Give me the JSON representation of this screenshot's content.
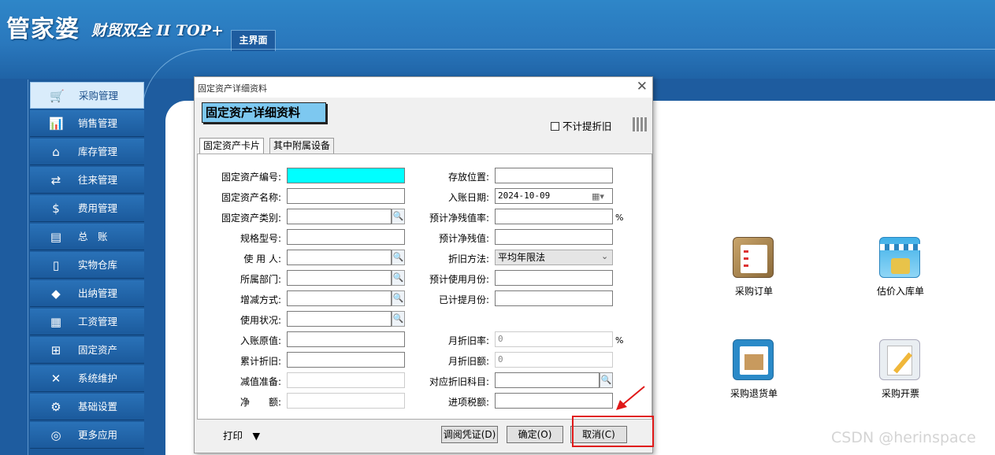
{
  "app": {
    "logo": "管家婆",
    "logo_sub": "财贸双全 II TOP+",
    "home_tab": "主界面"
  },
  "sidebar": {
    "items": [
      {
        "label": "采购管理",
        "icon": "cart-icon",
        "glyph": "🛒"
      },
      {
        "label": "销售管理",
        "icon": "chart-icon",
        "glyph": "📊"
      },
      {
        "label": "库存管理",
        "icon": "home-icon",
        "glyph": "⌂"
      },
      {
        "label": "往来管理",
        "icon": "exchange-icon",
        "glyph": "⇄"
      },
      {
        "label": "费用管理",
        "icon": "dollar-icon",
        "glyph": "$"
      },
      {
        "label": "总　账",
        "icon": "ledger-icon",
        "glyph": "▤"
      },
      {
        "label": "实物仓库",
        "icon": "document-icon",
        "glyph": "▯"
      },
      {
        "label": "出纳管理",
        "icon": "money-bag-icon",
        "glyph": "◆"
      },
      {
        "label": "工资管理",
        "icon": "grid-icon",
        "glyph": "▦"
      },
      {
        "label": "固定资产",
        "icon": "hierarchy-icon",
        "glyph": "⊞"
      },
      {
        "label": "系统维护",
        "icon": "tools-icon",
        "glyph": "✕"
      },
      {
        "label": "基础设置",
        "icon": "gear-icon",
        "glyph": "⚙"
      },
      {
        "label": "更多应用",
        "icon": "more-icon",
        "glyph": "◎"
      }
    ]
  },
  "tiles": [
    {
      "label": "采购订单",
      "icon": "clipboard-icon"
    },
    {
      "label": "估价入库单",
      "icon": "store-icon"
    },
    {
      "label": "采购退货单",
      "icon": "box-return-icon"
    },
    {
      "label": "采购开票",
      "icon": "invoice-icon"
    }
  ],
  "dialog": {
    "title": "固定资产详细资料",
    "heading": "固定资产详细资料",
    "no_depreciation_label": "不计提折旧",
    "tabs": [
      "固定资产卡片",
      "其中附属设备"
    ],
    "left_labels": [
      "固定资产编号:",
      "固定资产名称:",
      "固定资产类别:",
      "规格型号:",
      "使 用 人:",
      "所属部门:",
      "增减方式:",
      "使用状况:",
      "入账原值:",
      "累计折旧:",
      "减值准备:",
      "净　　额:"
    ],
    "right_labels": [
      "存放位置:",
      "入账日期:",
      "预计净残值率:",
      "预计净残值:",
      "折旧方法:",
      "预计使用月份:",
      "已计提月份:",
      "月折旧率:",
      "月折旧额:",
      "对应折旧科目:",
      "进项税额:"
    ],
    "entry_date": "2024-10-09",
    "depreciation_method": "平均年限法",
    "monthly_rate": "0",
    "monthly_amount": "0",
    "percent": "%",
    "print_label": "打印",
    "buttons": {
      "voucher": "调阅凭证(D)",
      "ok": "确定(O)",
      "cancel": "取消(C)"
    }
  },
  "watermark": "CSDN @herinspace",
  "colors": {
    "banner": "#2a78bd",
    "highlight": "#e01919",
    "selected_field": "#00ffff"
  }
}
